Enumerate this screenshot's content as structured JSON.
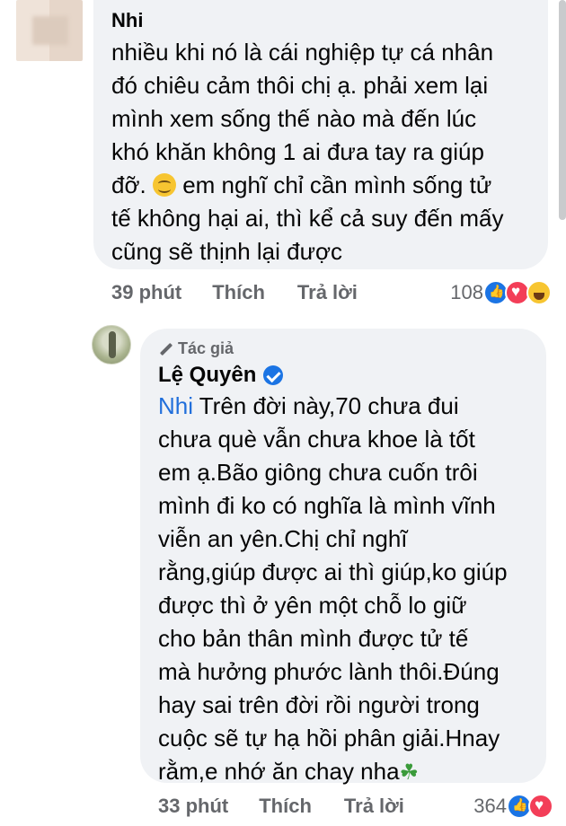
{
  "comment1": {
    "author": "Nhi",
    "text": "nhiều khi nó là cái nghiệp tự cá nhân\nđó chiêu cảm thôi chị ạ. phải xem lại\nmình xem sống thế nào mà đến lúc\nkhó khăn không 1 ai đưa tay ra giúp\nđỡ.",
    "text_after_emoji": " em nghĩ chỉ cần mình sống tử\ntế không hại ai, thì kể cả suy đến mấy\ncũng sẽ thịnh lại được",
    "emoji": "smiling-face",
    "time": "39 phút",
    "like_label": "Thích",
    "reply_label": "Trả lời",
    "reaction_count": "108",
    "reactions": [
      "like",
      "love",
      "haha"
    ]
  },
  "comment2": {
    "badge": "Tác giả",
    "author": "Lệ Quyên",
    "mention": "Nhi",
    "text": " Trên đời này,70 chưa đui\nchưa què vẫn chưa khoe là tốt\nem ạ.Bão giông chưa cuốn trôi\nmình đi ko có nghĩa là mình vĩnh\nviễn an yên.Chị chỉ nghĩ\nrằng,giúp được ai thì giúp,ko giúp\nđược thì ở yên một chỗ lo giữ\ncho bản thân mình được tử tế\nmà hưởng phước lành thôi.Đúng\nhay sai trên đời rồi người trong\ncuộc sẽ tự hạ hồi phân giải.Hnay\nrằm,e nhớ ăn chay nha",
    "emoji": "clover",
    "clover_glyph": "☘",
    "time": "33 phút",
    "like_label": "Thích",
    "reply_label": "Trả lời",
    "reaction_count": "364",
    "reactions": [
      "like",
      "love"
    ]
  },
  "colors": {
    "bubble": "#f0f2f5",
    "secondary_text": "#65676b",
    "mention": "#216fdb",
    "like_blue": "#1b74e4",
    "love_red": "#f33e58"
  }
}
